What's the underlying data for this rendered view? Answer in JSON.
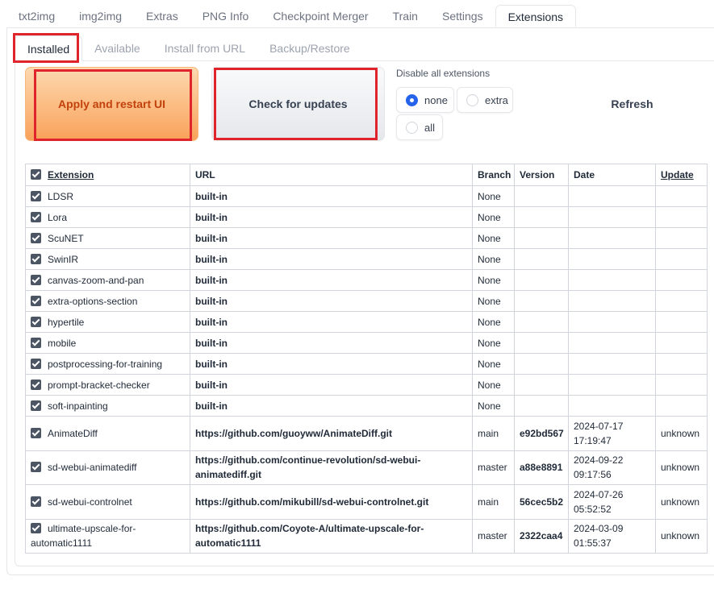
{
  "top_tabs": [
    "txt2img",
    "img2img",
    "Extras",
    "PNG Info",
    "Checkpoint Merger",
    "Train",
    "Settings",
    "Extensions"
  ],
  "sub_tabs": [
    "Installed",
    "Available",
    "Install from URL",
    "Backup/Restore"
  ],
  "buttons": {
    "apply": "Apply and restart UI",
    "check": "Check for updates",
    "refresh": "Refresh"
  },
  "disable": {
    "label": "Disable all extensions",
    "options": [
      "none",
      "extra",
      "all"
    ],
    "selected": "none"
  },
  "table": {
    "headers": [
      "Extension",
      "URL",
      "Branch",
      "Version",
      "Date",
      "Update"
    ],
    "rows": [
      {
        "name": "LDSR",
        "url": "built-in",
        "branch": "None",
        "version": "",
        "date": "",
        "update": ""
      },
      {
        "name": "Lora",
        "url": "built-in",
        "branch": "None",
        "version": "",
        "date": "",
        "update": ""
      },
      {
        "name": "ScuNET",
        "url": "built-in",
        "branch": "None",
        "version": "",
        "date": "",
        "update": ""
      },
      {
        "name": "SwinIR",
        "url": "built-in",
        "branch": "None",
        "version": "",
        "date": "",
        "update": ""
      },
      {
        "name": "canvas-zoom-and-pan",
        "url": "built-in",
        "branch": "None",
        "version": "",
        "date": "",
        "update": ""
      },
      {
        "name": "extra-options-section",
        "url": "built-in",
        "branch": "None",
        "version": "",
        "date": "",
        "update": ""
      },
      {
        "name": "hypertile",
        "url": "built-in",
        "branch": "None",
        "version": "",
        "date": "",
        "update": ""
      },
      {
        "name": "mobile",
        "url": "built-in",
        "branch": "None",
        "version": "",
        "date": "",
        "update": ""
      },
      {
        "name": "postprocessing-for-training",
        "url": "built-in",
        "branch": "None",
        "version": "",
        "date": "",
        "update": ""
      },
      {
        "name": "prompt-bracket-checker",
        "url": "built-in",
        "branch": "None",
        "version": "",
        "date": "",
        "update": ""
      },
      {
        "name": "soft-inpainting",
        "url": "built-in",
        "branch": "None",
        "version": "",
        "date": "",
        "update": ""
      },
      {
        "name": "AnimateDiff",
        "url": "https://github.com/guoyww/AnimateDiff.git",
        "branch": "main",
        "version": "e92bd567",
        "date_line1": "2024-07-17",
        "date_line2": "17:19:47",
        "update": "unknown"
      },
      {
        "name": "sd-webui-animatediff",
        "url_line1": "https://github.com/continue-revolution/sd-webui-",
        "url_line2": "animatediff.git",
        "branch": "master",
        "version": "a88e8891",
        "date_line1": "2024-09-22",
        "date_line2": "09:17:56",
        "update": "unknown"
      },
      {
        "name": "sd-webui-controlnet",
        "url": "https://github.com/mikubill/sd-webui-controlnet.git",
        "branch": "main",
        "version": "56cec5b2",
        "date_line1": "2024-07-26",
        "date_line2": "05:52:52",
        "update": "unknown"
      },
      {
        "name_line1": "ultimate-upscale-for-",
        "name_line2": "automatic1111",
        "url_line1": "https://github.com/Coyote-A/ultimate-upscale-for-",
        "url_line2": "automatic1111",
        "branch": "master",
        "version": "2322caa4",
        "date_line1": "2024-03-09",
        "date_line2": "01:55:37",
        "update": "unknown"
      }
    ]
  },
  "colors": {
    "accent_orange": "#c2410c",
    "highlight_red": "#e0242b",
    "radio_blue": "#2563eb"
  }
}
